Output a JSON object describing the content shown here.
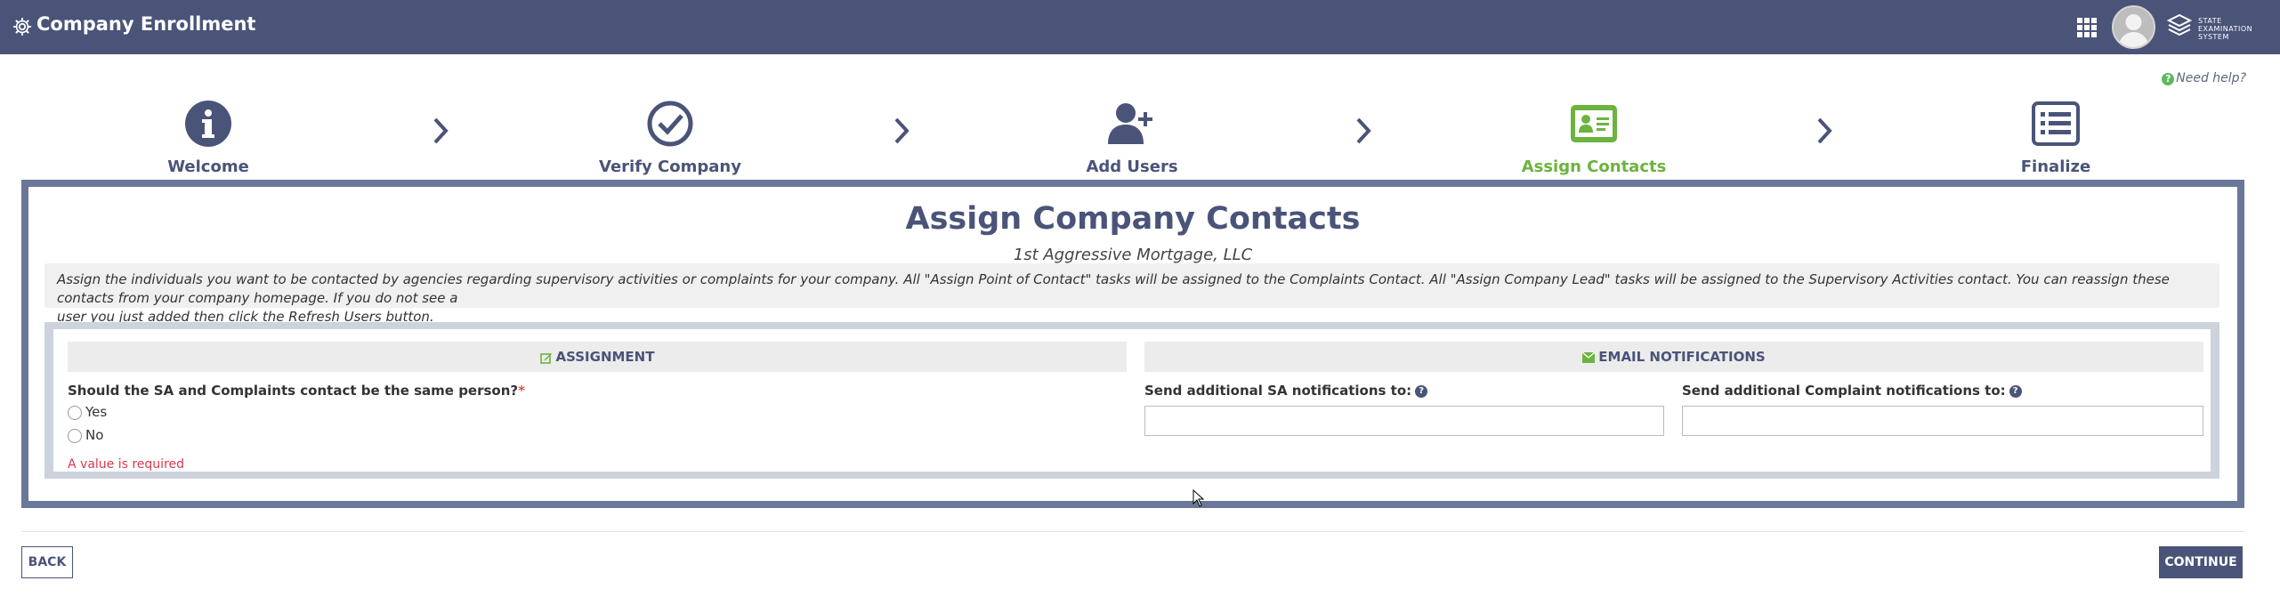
{
  "header": {
    "title": "Company Enrollment",
    "logo_text": "STATE EXAMINATION SYSTEM"
  },
  "need_help": "Need help?",
  "steps": [
    {
      "label": "Welcome",
      "icon": "info-circle-icon"
    },
    {
      "label": "Verify Company",
      "icon": "check-circle-icon"
    },
    {
      "label": "Add Users",
      "icon": "user-plus-icon"
    },
    {
      "label": "Assign Contacts",
      "icon": "contact-card-icon",
      "active": true
    },
    {
      "label": "Finalize",
      "icon": "list-icon"
    }
  ],
  "panel": {
    "title": "Assign Company Contacts",
    "subtitle": "1st Aggressive Mortgage, LLC",
    "info_line1": "Assign the individuals you want to be contacted by agencies regarding supervisory activities or complaints for your company. All \"Assign Point of Contact\" tasks will be assigned to the Complaints Contact. All \"Assign Company Lead\" tasks will be assigned to the Supervisory Activities contact. You can reassign these contacts from your company homepage. If you do not see a",
    "info_line2": "user you just added then click the Refresh Users button."
  },
  "assignment": {
    "heading": "ASSIGNMENT",
    "question": "Should the SA and Complaints contact be the same person?",
    "required_mark": "*",
    "options": [
      "Yes",
      "No"
    ],
    "error": "A value is required"
  },
  "email": {
    "heading": "EMAIL NOTIFICATIONS",
    "sa_label": "Send additional SA notifications to:",
    "complaint_label": "Send additional Complaint notifications to:",
    "sa_value": "",
    "complaint_value": ""
  },
  "buttons": {
    "back": "BACK",
    "continue": "CONTINUE"
  },
  "colors": {
    "primary": "#4a5479",
    "active_step": "#6cb33f",
    "error": "#d9384f"
  }
}
